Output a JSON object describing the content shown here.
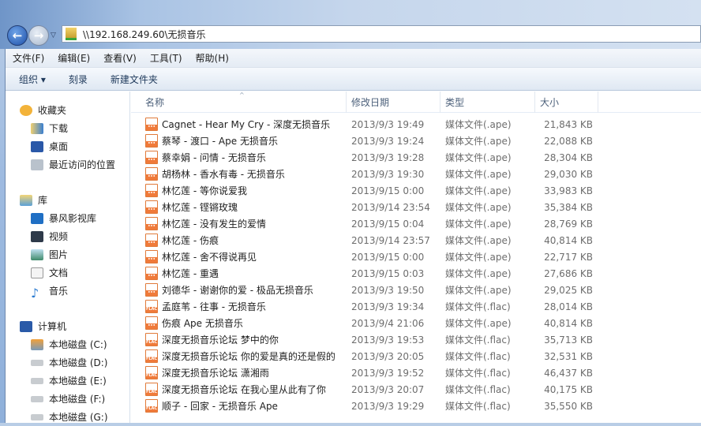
{
  "address": "\\\\192.168.249.60\\无损音乐",
  "menu": [
    "文件(F)",
    "编辑(E)",
    "查看(V)",
    "工具(T)",
    "帮助(H)"
  ],
  "toolbar": {
    "organize": "组织 ▾",
    "burn": "刻录",
    "new_folder": "新建文件夹"
  },
  "sidebar": {
    "favorites": {
      "label": "收藏夹",
      "items": [
        "下载",
        "桌面",
        "最近访问的位置"
      ]
    },
    "libraries": {
      "label": "库",
      "items": [
        "暴风影视库",
        "视频",
        "图片",
        "文档",
        "音乐"
      ]
    },
    "computer": {
      "label": "计算机",
      "items": [
        "本地磁盘 (C:)",
        "本地磁盘 (D:)",
        "本地磁盘 (E:)",
        "本地磁盘 (F:)",
        "本地磁盘 (G:)"
      ]
    }
  },
  "columns": [
    "名称",
    "修改日期",
    "类型",
    "大小"
  ],
  "files": [
    {
      "name": "Cagnet - Hear My Cry - 深度无损音乐",
      "date": "2013/9/3 19:49",
      "type": "媒体文件(.ape)",
      "size": "21,843 KB",
      "icon": "ape"
    },
    {
      "name": "蔡琴 - 渡口 - Ape 无损音乐",
      "date": "2013/9/3 19:24",
      "type": "媒体文件(.ape)",
      "size": "22,088 KB",
      "icon": "ape"
    },
    {
      "name": "蔡幸娟 - 问情 - 无损音乐",
      "date": "2013/9/3 19:28",
      "type": "媒体文件(.ape)",
      "size": "28,304 KB",
      "icon": "ape"
    },
    {
      "name": "胡杨林 - 香水有毒 - 无损音乐",
      "date": "2013/9/3 19:30",
      "type": "媒体文件(.ape)",
      "size": "29,030 KB",
      "icon": "ape"
    },
    {
      "name": "林忆莲 - 等你说爱我",
      "date": "2013/9/15 0:00",
      "type": "媒体文件(.ape)",
      "size": "33,983 KB",
      "icon": "ape"
    },
    {
      "name": "林忆莲 - 铿锵玫瑰",
      "date": "2013/9/14 23:54",
      "type": "媒体文件(.ape)",
      "size": "35,384 KB",
      "icon": "ape"
    },
    {
      "name": "林忆莲 - 没有发生的爱情",
      "date": "2013/9/15 0:04",
      "type": "媒体文件(.ape)",
      "size": "28,769 KB",
      "icon": "ape"
    },
    {
      "name": "林忆莲 - 伤痕",
      "date": "2013/9/14 23:57",
      "type": "媒体文件(.ape)",
      "size": "40,814 KB",
      "icon": "ape"
    },
    {
      "name": "林忆莲 - 舍不得说再见",
      "date": "2013/9/15 0:00",
      "type": "媒体文件(.ape)",
      "size": "22,717 KB",
      "icon": "ape"
    },
    {
      "name": "林忆莲 - 重遇",
      "date": "2013/9/15 0:03",
      "type": "媒体文件(.ape)",
      "size": "27,686 KB",
      "icon": "ape"
    },
    {
      "name": "刘德华 - 谢谢你的爱 - 极品无损音乐",
      "date": "2013/9/3 19:50",
      "type": "媒体文件(.ape)",
      "size": "29,025 KB",
      "icon": "ape"
    },
    {
      "name": "孟庭苇 - 往事 - 无损音乐",
      "date": "2013/9/3 19:34",
      "type": "媒体文件(.flac)",
      "size": "28,014 KB",
      "icon": "flac"
    },
    {
      "name": "伤痕 Ape 无损音乐",
      "date": "2013/9/4 21:06",
      "type": "媒体文件(.ape)",
      "size": "40,814 KB",
      "icon": "ape"
    },
    {
      "name": "深度无损音乐论坛 梦中的你",
      "date": "2013/9/3 19:53",
      "type": "媒体文件(.flac)",
      "size": "35,713 KB",
      "icon": "flac"
    },
    {
      "name": "深度无损音乐论坛 你的爱是真的还是假的",
      "date": "2013/9/3 20:05",
      "type": "媒体文件(.flac)",
      "size": "32,531 KB",
      "icon": "flac"
    },
    {
      "name": "深度无损音乐论坛 潇湘雨",
      "date": "2013/9/3 19:52",
      "type": "媒体文件(.flac)",
      "size": "46,437 KB",
      "icon": "flac"
    },
    {
      "name": "深度无损音乐论坛 在我心里从此有了你",
      "date": "2013/9/3 20:07",
      "type": "媒体文件(.flac)",
      "size": "40,175 KB",
      "icon": "flac"
    },
    {
      "name": "顺子 - 回家 - 无损音乐 Ape",
      "date": "2013/9/3 19:29",
      "type": "媒体文件(.flac)",
      "size": "35,550 KB",
      "icon": "flac"
    }
  ]
}
